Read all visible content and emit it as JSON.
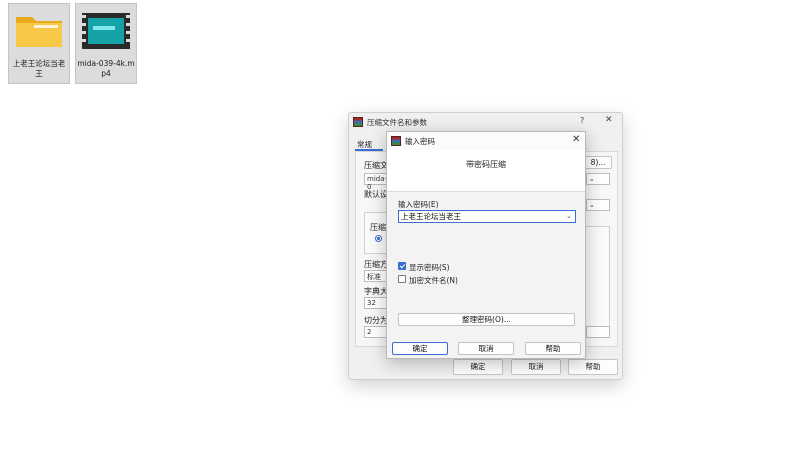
{
  "desktop": {
    "icons": [
      {
        "label": "上老王论坛当老王",
        "type": "folder"
      },
      {
        "label": "mida-039-4k.mp4",
        "type": "video"
      }
    ]
  },
  "bg_dialog": {
    "title": "压缩文件名和参数",
    "help_glyph": "?",
    "close_glyph": "✕",
    "tab_general": "常规",
    "label_archive_name": "压缩文",
    "archive_name_value": "mida-0",
    "browse_button_partial": "8)...",
    "label_default": "默认设",
    "label_format": "压缩文",
    "label_method": "压缩方",
    "method_value": "标准",
    "label_dict": "字典大",
    "dict_value": "32",
    "label_split": "切分为",
    "split_value": "2",
    "ok_button": "确定",
    "cancel_button": "取消",
    "help_button": "帮助"
  },
  "pwd_dialog": {
    "title": "输入密码",
    "close_glyph": "✕",
    "header": "带密码压缩",
    "password_label": "输入密码(E)",
    "password_value": "上老王论坛当老王",
    "show_password_label": "显示密码(S)",
    "show_password_checked": true,
    "encrypt_names_label": "加密文件名(N)",
    "encrypt_names_checked": false,
    "organize_button": "整理密码(O)...",
    "ok_button": "确定",
    "cancel_button": "取消",
    "help_button": "帮助"
  },
  "colors": {
    "accent": "#3b6ed1"
  }
}
